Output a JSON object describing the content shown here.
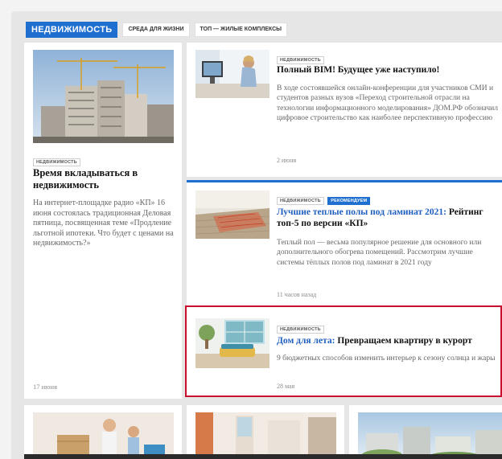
{
  "tabs": {
    "main": "НЕДВИЖИМОСТЬ",
    "sub": [
      "СРЕДА ДЛЯ ЖИЗНИ",
      "ТОП — ЖИЛЫЕ КОМПЛЕКСЫ"
    ]
  },
  "left_article": {
    "badge": "НЕДВИЖИМОСТЬ",
    "title": "Время вкладываться в недвижимость",
    "text": "На интернет-площадке радио «КП» 16 июня состоялась традиционная Деловая пятница, посвященная теме «Продление льготной ипотеки. Что будет с ценами на недвижимость?»",
    "date": "17 июня",
    "image": "construction-cranes-photo"
  },
  "article_bim": {
    "badge": "НЕДВИЖИМОСТЬ",
    "title": "Полный BIM! Будущее уже наступило!",
    "text": "В ходе состоявшейся онлайн-конференции для участников СМИ и студентов разных вузов «Переход строительной отрасли на технологии информационного моделирования» ДОМ.РФ обозначил цифровое строительство как наиболее перспективную профессию",
    "date": "2 июня",
    "image": "woman-at-computer-photo"
  },
  "article_floors": {
    "badges": [
      "НЕДВИЖИМОСТЬ",
      "РЕКОМЕНДУЕМ"
    ],
    "title_link": "Лучшие теплые полы под ламинат 2021:",
    "title_rest": "Рейтинг топ-5 по версии «КП»",
    "text": "Теплый пол — весьма популярное решение для основного или дополнительного обогрева помещений. Рассмотрим лучшие системы тёплых полов под ламинат в 2021 году",
    "date": "11 часов назад",
    "image": "heated-floor-photo"
  },
  "article_summer": {
    "badge": "НЕДВИЖИМОСТЬ",
    "title_link": "Дом для лета:",
    "title_rest": "Превращаем квартиру в курорт",
    "text": "9 бюджетных способов изменить интерьер к сезону солнца и жары",
    "date": "28 мая",
    "image": "living-room-photo"
  },
  "bottom_cards": [
    "family-with-boxes-photo",
    "apartment-interior-photo",
    "residential-complex-photo"
  ],
  "colors": {
    "accent": "#1f6fd0",
    "highlight": "#c8102e",
    "link": "#1f5fbf"
  }
}
